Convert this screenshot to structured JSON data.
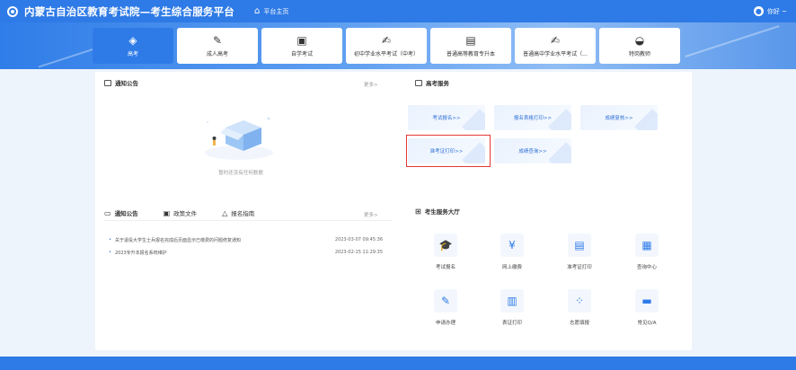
{
  "header": {
    "site_title": "内蒙古自治区教育考试院—考生综合服务平台",
    "home_label": "平台主页",
    "user_label": "你好 ~"
  },
  "categories": [
    {
      "label": "高考",
      "icon": "exam-cup-icon",
      "glyph": "◈",
      "active": true
    },
    {
      "label": "成人高考",
      "icon": "pen-icon",
      "glyph": "✎",
      "active": false
    },
    {
      "label": "自学考试",
      "icon": "screen-icon",
      "glyph": "▣",
      "active": false
    },
    {
      "label": "初中学业水平考试（中考）",
      "icon": "edit-doc-icon",
      "glyph": "✍",
      "active": false
    },
    {
      "label": "普通高等教育专升本",
      "icon": "building-icon",
      "glyph": "▤",
      "active": false
    },
    {
      "label": "普通高中学业水平考试（...",
      "icon": "edit-doc-icon",
      "glyph": "✍",
      "active": false
    },
    {
      "label": "特岗教师",
      "icon": "graduation-cap-icon",
      "glyph": "◒",
      "active": false
    }
  ],
  "notice_panel": {
    "title": "通知公告",
    "more": "更多>",
    "empty_text": "暂时还没有任何数据"
  },
  "gaokao_panel": {
    "title": "高考服务",
    "buttons": [
      {
        "label": "考试报名>>"
      },
      {
        "label": "报名表格打印>>"
      },
      {
        "label": "成绩复核>>"
      },
      {
        "label": "准考证打印>>"
      },
      {
        "label": "成绩查询>>"
      }
    ]
  },
  "tabs": {
    "items": [
      {
        "label": "通知公告",
        "icon": "notice-icon",
        "glyph": "▭"
      },
      {
        "label": "政策文件",
        "icon": "document-icon",
        "glyph": "▣"
      },
      {
        "label": "报名指南",
        "icon": "guide-icon",
        "glyph": "△"
      }
    ],
    "more": "更多>"
  },
  "notices": [
    {
      "text": "关于退役大学生士兵报名完成后页面显示已缴费的问题修复通知",
      "time": "2023-03-07 09:45:36"
    },
    {
      "text": "2023专升本报名系统维护",
      "time": "2023-02-15 11:29:35"
    }
  ],
  "service_hall": {
    "title": "考生服务大厅",
    "items": [
      {
        "label": "考试报名",
        "icon": "graduation-cap-icon",
        "glyph": "🎓"
      },
      {
        "label": "网上缴费",
        "icon": "payment-icon",
        "glyph": "¥"
      },
      {
        "label": "准考证打印",
        "icon": "printer-icon",
        "glyph": "▤"
      },
      {
        "label": "查询中心",
        "icon": "query-doc-icon",
        "glyph": "▦"
      },
      {
        "label": "申请办理",
        "icon": "apply-edit-icon",
        "glyph": "✎"
      },
      {
        "label": "表证打印",
        "icon": "form-print-icon",
        "glyph": "▥"
      },
      {
        "label": "志愿填报",
        "icon": "grid-apps-icon",
        "glyph": "⁘"
      },
      {
        "label": "常见Q/A",
        "icon": "chat-qa-icon",
        "glyph": "▬"
      }
    ]
  }
}
